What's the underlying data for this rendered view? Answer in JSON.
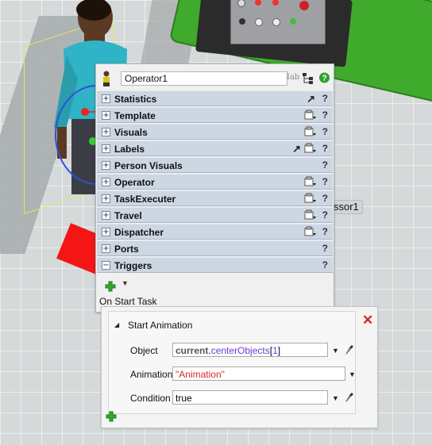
{
  "object_name": "Operator1",
  "scene": {
    "background_label": "ssor1"
  },
  "sections": [
    {
      "label": "Statistics",
      "expander": "+",
      "icons": [
        "pointer-arrow-icon"
      ]
    },
    {
      "label": "Template",
      "expander": "+",
      "icons": [
        "properties-icon"
      ]
    },
    {
      "label": "Visuals",
      "expander": "+",
      "icons": [
        "properties-icon"
      ]
    },
    {
      "label": "Labels",
      "expander": "+",
      "icons": [
        "pointer-arrow-icon",
        "properties-icon"
      ]
    },
    {
      "label": "Person Visuals",
      "expander": "+",
      "icons": []
    },
    {
      "label": "Operator",
      "expander": "+",
      "icons": [
        "properties-icon"
      ]
    },
    {
      "label": "TaskExecuter",
      "expander": "+",
      "icons": [
        "properties-icon"
      ]
    },
    {
      "label": "Travel",
      "expander": "+",
      "icons": [
        "properties-icon"
      ]
    },
    {
      "label": "Dispatcher",
      "expander": "+",
      "icons": [
        "properties-icon"
      ]
    },
    {
      "label": "Ports",
      "expander": "+",
      "icons": []
    },
    {
      "label": "Triggers",
      "expander": "−",
      "icons": []
    }
  ],
  "help_label": "?",
  "triggers": {
    "event_label": "On Start Task"
  },
  "trigger_action": {
    "title": "Start Animation",
    "fields": {
      "object": {
        "label": "Object",
        "keyword": "current",
        "separator": ".",
        "property": "centerObjects",
        "open_bracket": "[",
        "index": "1",
        "close_bracket": "]"
      },
      "animation": {
        "label": "Animation",
        "value": "\"Animation\""
      },
      "condition": {
        "label": "Condition",
        "value": "true"
      }
    }
  },
  "colors": {
    "section_bg": "#cdd7e3",
    "close_red": "#e02020",
    "add_green": "#2eaa2e"
  }
}
